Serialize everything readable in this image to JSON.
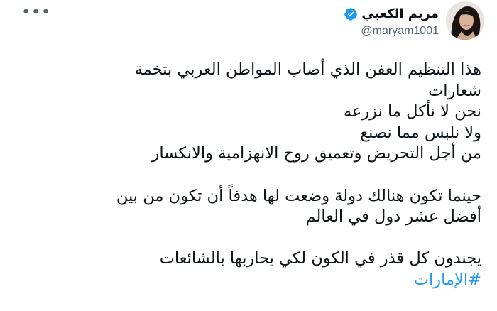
{
  "tweet": {
    "more_menu": "•••",
    "author": {
      "display_name": "مريم الكعبي",
      "handle": "@maryam1001",
      "verified": true
    },
    "text": {
      "line1": "هذا التنظيم العفن الذي أصاب المواطن العربي بتخمة",
      "line2": "شعارات",
      "line3": "نحن لا نأكل ما نزرعه",
      "line4": "ولا نلبس مما نصنع",
      "line5": "من أجل التحريض وتعميق روح الانهزامية والانكسار",
      "line6": "حينما تكون هنالك دولة وضعت لها هدفاً أن تكون من بين",
      "line7": "أفضل عشر دول في العالم",
      "line8": "يجندون كل قذر في الكون لكي يحاربها بالشائعات"
    },
    "hashtag": "#الإمارات"
  },
  "colors": {
    "text": "#0f1419",
    "secondary": "#536471",
    "link": "#1d9bf0",
    "verified": "#1d9bf0"
  }
}
